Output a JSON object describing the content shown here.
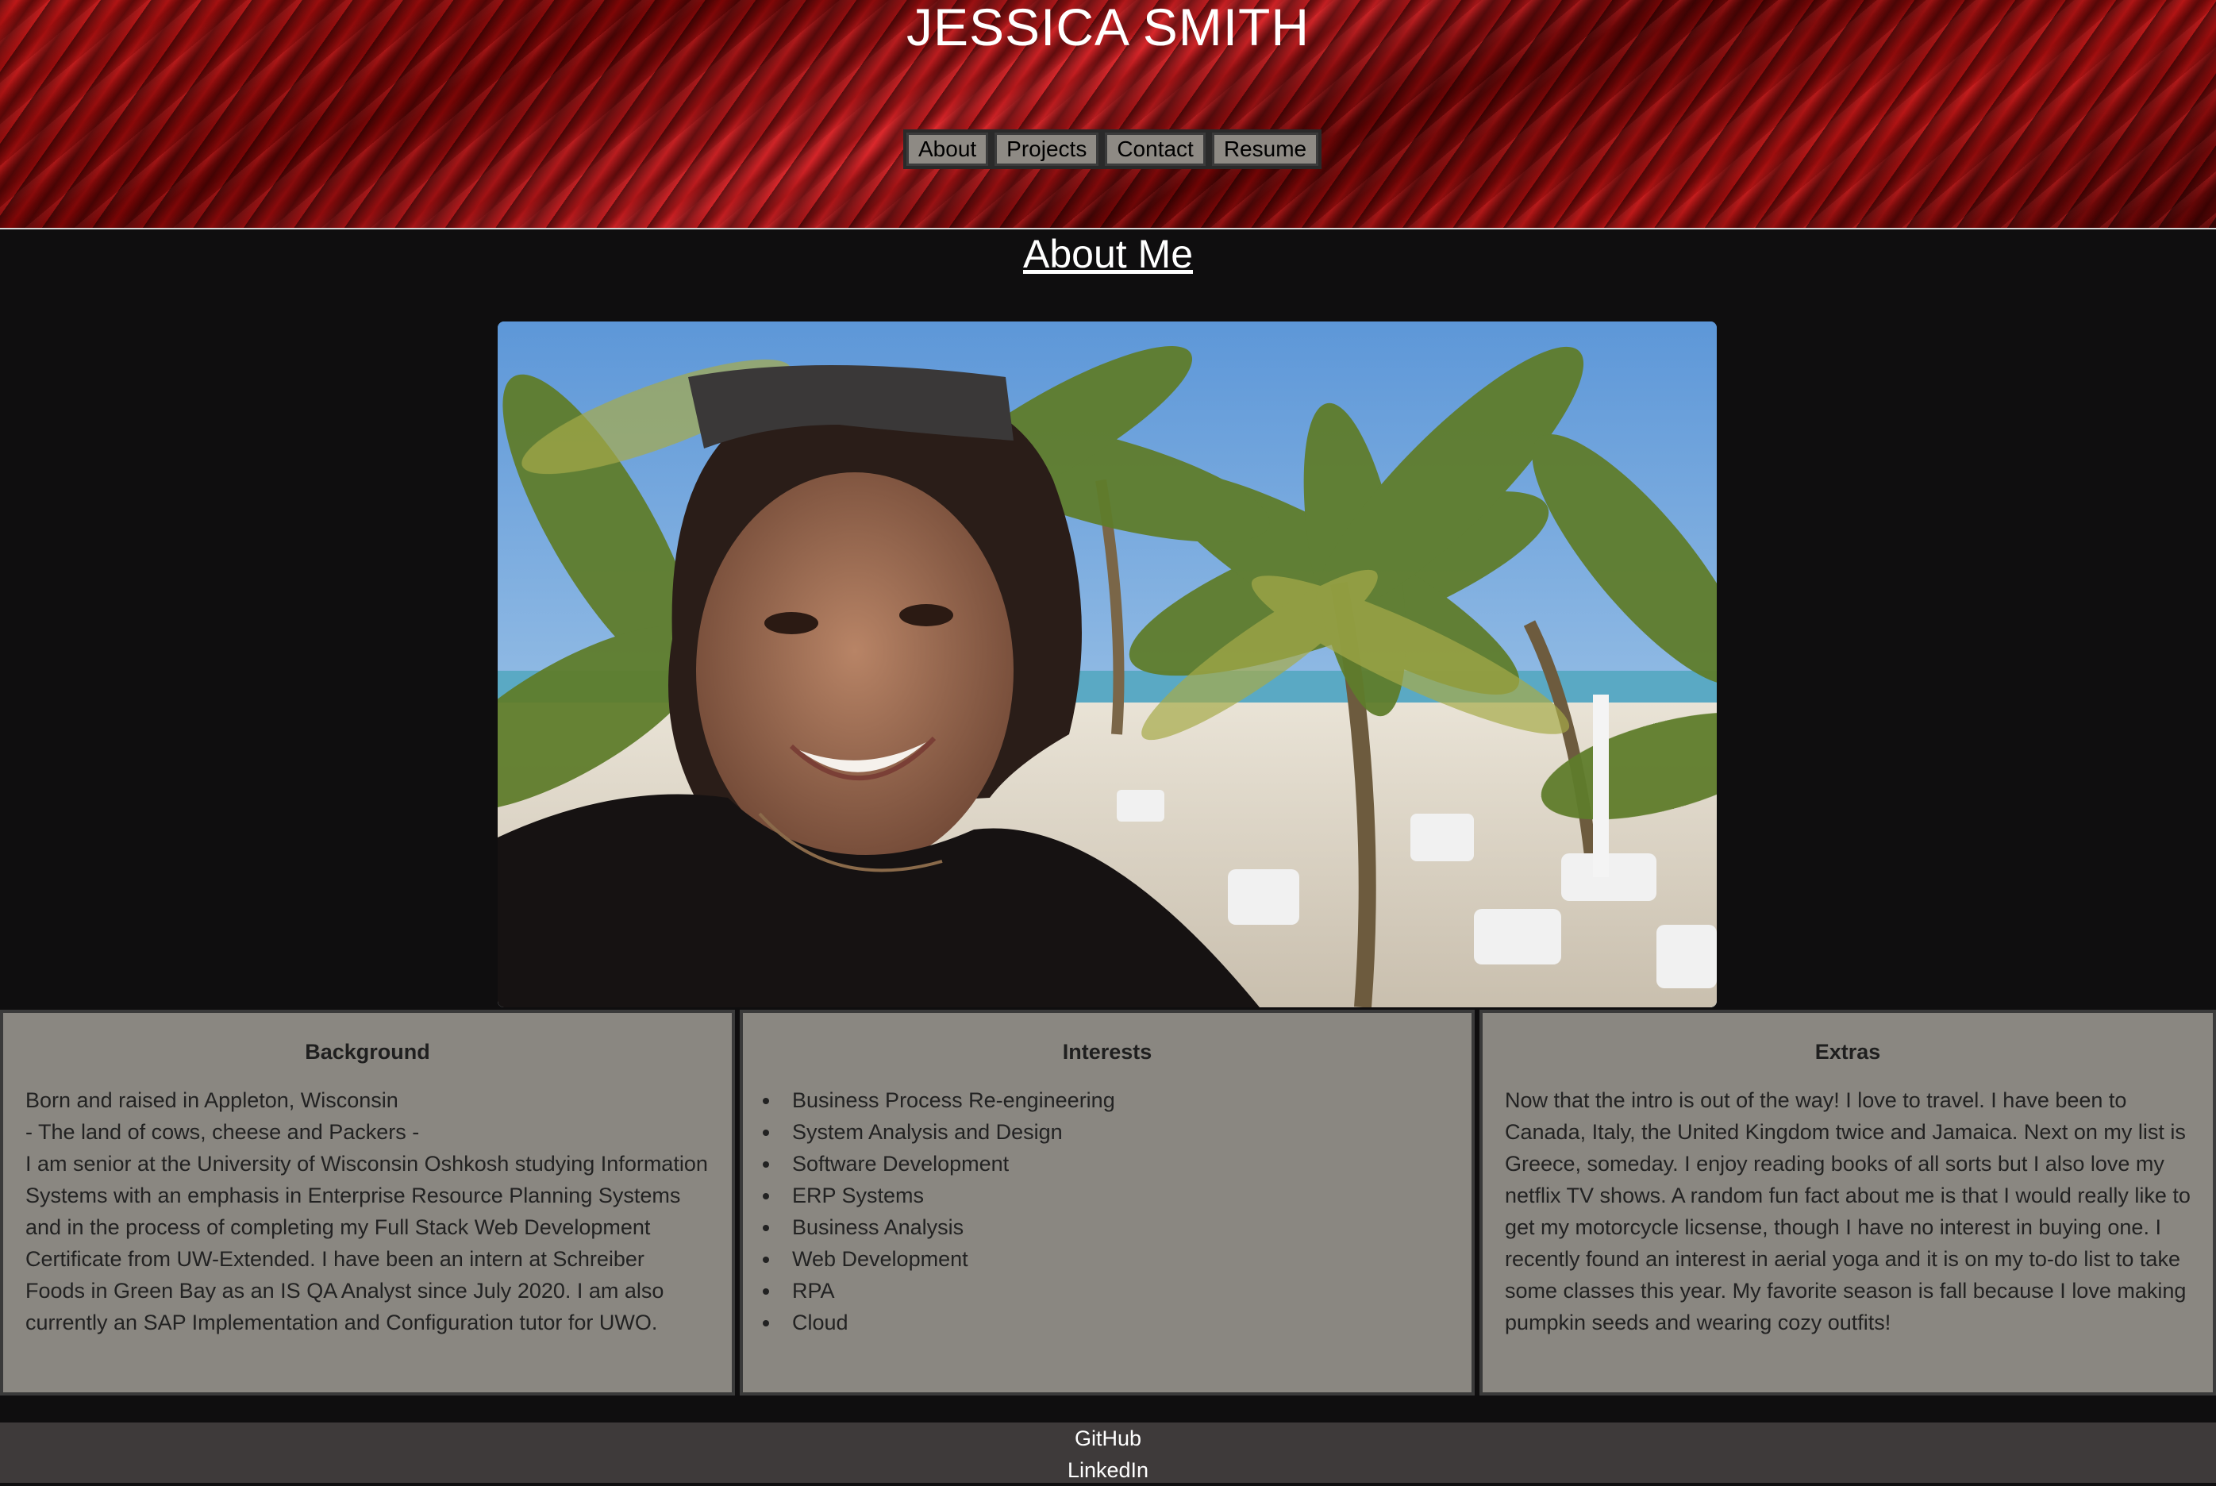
{
  "header": {
    "title": "JESSICA SMITH",
    "nav": [
      "About",
      "Projects",
      "Contact",
      "Resume"
    ]
  },
  "main": {
    "heading": "About Me",
    "photo": "profile-photo"
  },
  "cards": {
    "background": {
      "title": "Background",
      "lines": [
        "Born and raised in Appleton, Wisconsin",
        "- The land of cows, cheese and Packers -",
        "I am senior at the University of Wisconsin Oshkosh studying Information Systems with an emphasis in Enterprise Resource Planning Systems and in the process of completing my Full Stack Web Development Certificate from UW-Extended. I have been an intern at Schreiber Foods in Green Bay as an IS QA Analyst since July 2020. I am also currently an SAP Implementation and Configuration tutor for UWO."
      ]
    },
    "interests": {
      "title": "Interests",
      "items": [
        "Business Process Re-engineering",
        "System Analysis and Design",
        "Software Development",
        "ERP Systems",
        "Business Analysis",
        "Web Development",
        "RPA",
        "Cloud"
      ]
    },
    "extras": {
      "title": "Extras",
      "text": "Now that the intro is out of the way! I love to travel. I have been to Canada, Italy, the United Kingdom twice and Jamaica. Next on my list is Greece, someday. I enjoy reading books of all sorts but I also love my netflix TV shows. A random fun fact about me is that I would really like to get my motorcycle licsense, though I have no interest in buying one. I recently found an interest in aerial yoga and it is on my to-do list to take some classes this year. My favorite season is fall because I love making pumpkin seeds and wearing cozy outfits!"
    }
  },
  "footer": {
    "links": [
      "GitHub",
      "LinkedIn"
    ]
  }
}
